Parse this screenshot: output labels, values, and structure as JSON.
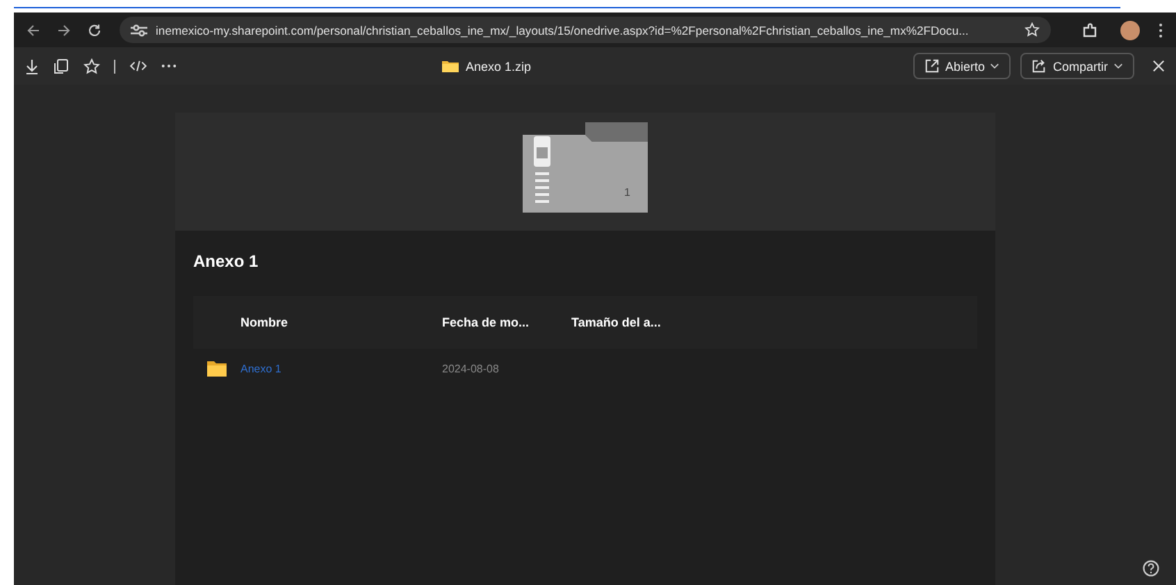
{
  "browser": {
    "url": "inemexico-my.sharepoint.com/personal/christian_ceballos_ine_mx/_layouts/15/onedrive.aspx?id=%2Fpersonal%2Fchristian_ceballos_ine_mx%2FDocu..."
  },
  "toolbar": {
    "file_name": "Anexo 1.zip",
    "buttons": [
      {
        "label": "Abierto",
        "kind": "open"
      },
      {
        "label": "Compartir",
        "kind": "share"
      }
    ]
  },
  "preview": {
    "badge": "1"
  },
  "archive": {
    "title": "Anexo 1",
    "columns": [
      "Nombre",
      "Fecha de mo...",
      "Tamaño del a..."
    ],
    "rows": [
      {
        "name": "Anexo 1",
        "date": "2024-08-08",
        "size": ""
      }
    ]
  }
}
